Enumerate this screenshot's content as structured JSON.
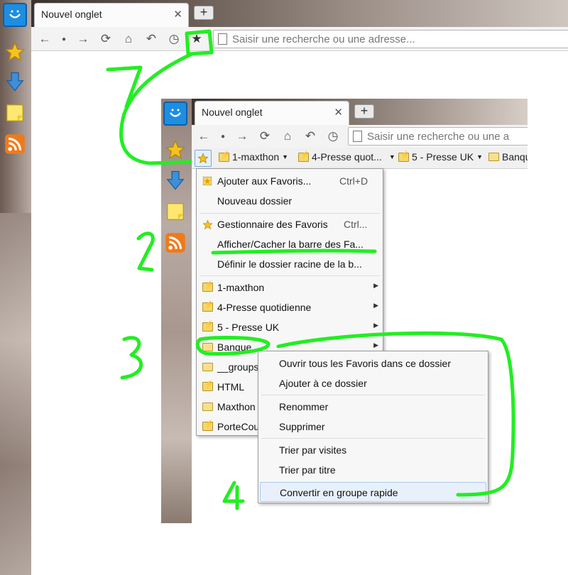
{
  "browser": {
    "tab_title": "Nouvel onglet",
    "tab_close": "✕",
    "new_tab": "+",
    "address_placeholder": "Saisir une recherche ou une adresse...",
    "address_placeholder_inner": "Saisir une recherche ou une a"
  },
  "toolbar_icons": [
    "back-icon",
    "dot-icon",
    "forward-icon",
    "refresh-icon",
    "home-icon",
    "undo-icon",
    "history-icon",
    "favorites-star-icon"
  ],
  "sidebar_icons": [
    "maxthon-logo-icon",
    "favorites-star-icon",
    "download-icon",
    "notes-icon",
    "rss-icon"
  ],
  "bookmarks_bar": [
    {
      "label": "1-maxthon",
      "type": "group"
    },
    {
      "label": "4-Presse quot...",
      "type": "group"
    },
    {
      "label": "5 - Presse UK",
      "type": "group"
    },
    {
      "label": "Banqu",
      "type": "folder"
    }
  ],
  "favorites_menu": [
    {
      "label": "Ajouter aux Favoris...",
      "shortcut": "Ctrl+D",
      "icon": "add-favorite-icon"
    },
    {
      "label": "Nouveau dossier"
    },
    {
      "label": "Gestionnaire des Favoris",
      "shortcut": "Ctrl...",
      "icon": "star-icon"
    },
    {
      "label": "Afficher/Cacher la barre des Fa..."
    },
    {
      "label": "Définir le dossier racine de la b..."
    },
    {
      "label": "1-maxthon",
      "submenu": true,
      "icon": "group"
    },
    {
      "label": "4-Presse quotidienne",
      "submenu": true,
      "icon": "group"
    },
    {
      "label": "5 - Presse UK",
      "submenu": true,
      "icon": "group"
    },
    {
      "label": "Banque",
      "submenu": true,
      "icon": "folder"
    },
    {
      "label": "__groups",
      "icon": "folder"
    },
    {
      "label": "HTML",
      "icon": "group"
    },
    {
      "label": "Maxthon",
      "icon": "folder"
    },
    {
      "label": "PorteCou",
      "icon": "group"
    }
  ],
  "context_menu": [
    {
      "label": "Ouvrir tous les Favoris dans ce dossier"
    },
    {
      "label": "Ajouter à ce dossier"
    },
    {
      "label": "Renommer"
    },
    {
      "label": "Supprimer"
    },
    {
      "label": "Trier par visites"
    },
    {
      "label": "Trier par titre"
    },
    {
      "label": "Convertir en groupe rapide",
      "highlighted": true
    }
  ],
  "annotations": {
    "step1": "1",
    "step2": "2",
    "step3": "3",
    "step4": "4",
    "color": "#22ee22"
  }
}
